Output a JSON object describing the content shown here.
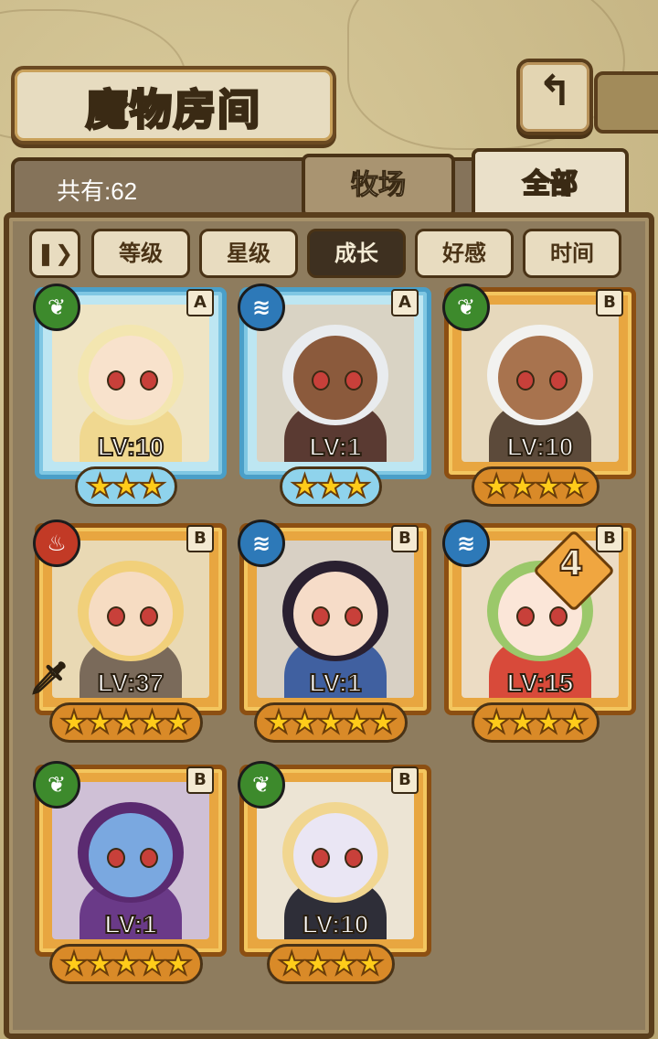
{
  "header": {
    "title": "魔物房间",
    "back_icon": "back-arrow-icon"
  },
  "tabs": {
    "count_label": "共有:62",
    "ranch_label": "牧场",
    "all_label": "全部",
    "active": "all"
  },
  "sort": {
    "toggle_icon": "pause-sort-icon",
    "buttons": [
      {
        "label": "等级",
        "active": false
      },
      {
        "label": "星级",
        "active": false
      },
      {
        "label": "成长",
        "active": true
      },
      {
        "label": "好感",
        "active": false
      },
      {
        "label": "时间",
        "active": false
      }
    ]
  },
  "colors": {
    "frame_A": "#4a9fc8",
    "frame_B": "#e8a640",
    "element_nature": "#3d8a2c",
    "element_water": "#2d79b8",
    "element_fire": "#c23a26",
    "star": "#ffcc1a"
  },
  "monsters": [
    {
      "rank": "A",
      "element": "nature",
      "element_icon": "leaf-icon",
      "level": "LV:10",
      "stars": 3
    },
    {
      "rank": "A",
      "element": "water",
      "element_icon": "water-waves-icon",
      "level": "LV:1",
      "stars": 3
    },
    {
      "rank": "B",
      "element": "nature",
      "element_icon": "leaf-icon",
      "level": "LV:10",
      "stars": 4
    },
    {
      "rank": "B",
      "element": "fire",
      "element_icon": "flame-icon",
      "level": "LV:37",
      "stars": 5,
      "weapon_icon": "sword-icon"
    },
    {
      "rank": "B",
      "element": "water",
      "element_icon": "water-waves-icon",
      "level": "LV:1",
      "stars": 5
    },
    {
      "rank": "B",
      "element": "water",
      "element_icon": "water-waves-icon",
      "level": "LV:15",
      "stars": 4,
      "grade": "4"
    },
    {
      "rank": "B",
      "element": "nature",
      "element_icon": "leaf-icon",
      "level": "LV:1",
      "stars": 5
    },
    {
      "rank": "B",
      "element": "nature",
      "element_icon": "leaf-icon",
      "level": "LV:10",
      "stars": 4
    }
  ]
}
